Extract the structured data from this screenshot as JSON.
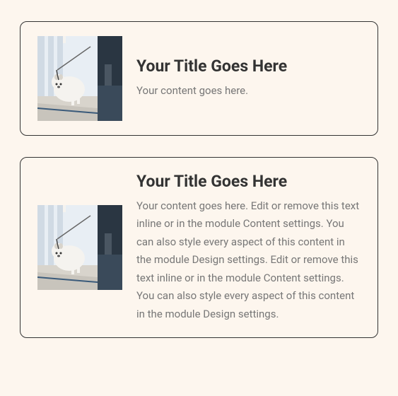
{
  "cards": [
    {
      "title": "Your Title Goes Here",
      "content": "Your content goes here."
    },
    {
      "title": "Your Title Goes Here",
      "content": "Your content goes here. Edit or remove this text inline or in the module Content settings. You can also style every aspect of this content in the module Design settings. Edit or remove this text inline or in the module Content settings. You can also style every aspect of this content in the module Design settings."
    }
  ]
}
